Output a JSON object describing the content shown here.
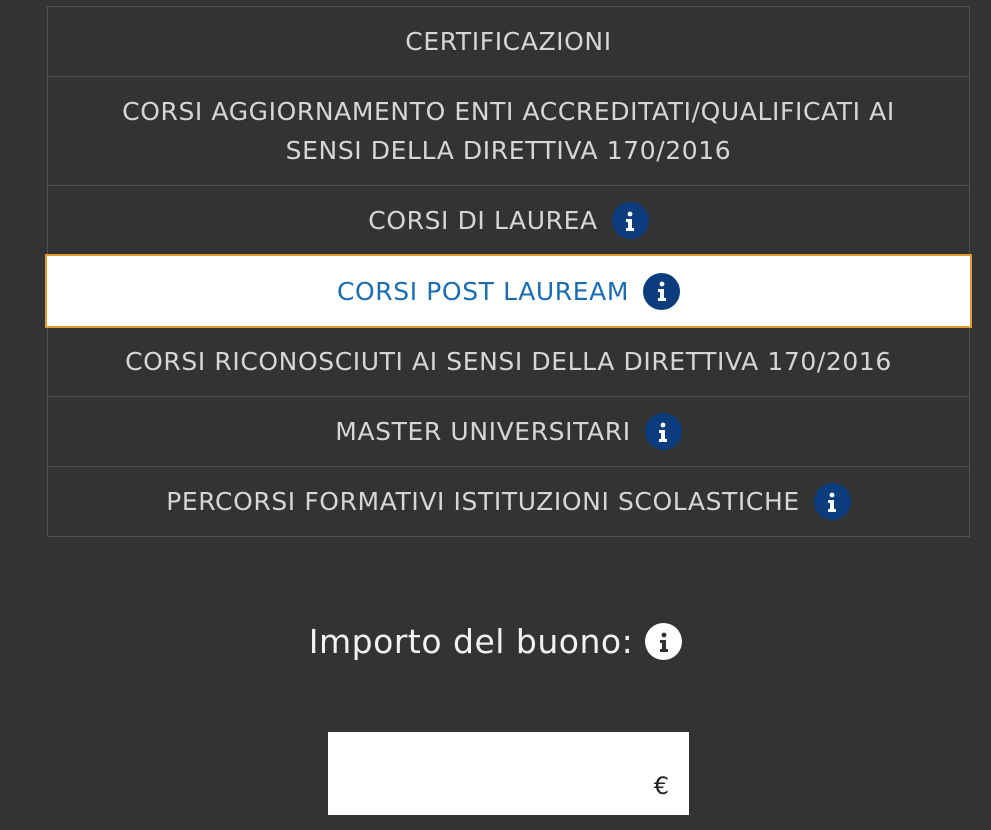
{
  "categories": [
    {
      "label": "CERTIFICAZIONI",
      "info": false,
      "selected": false
    },
    {
      "label": "CORSI AGGIORNAMENTO ENTI ACCREDITATI/QUALIFICATI AI SENSI DELLA DIRETTIVA 170/2016",
      "info": false,
      "selected": false
    },
    {
      "label": "CORSI DI LAUREA",
      "info": true,
      "selected": false
    },
    {
      "label": "CORSI POST LAUREAM",
      "info": true,
      "selected": true
    },
    {
      "label": "CORSI RICONOSCIUTI AI SENSI DELLA DIRETTIVA 170/2016",
      "info": false,
      "selected": false
    },
    {
      "label": "MASTER UNIVERSITARI",
      "info": true,
      "selected": false
    },
    {
      "label": "PERCORSI FORMATIVI ISTITUZIONI SCOLASTICHE",
      "info": true,
      "selected": false
    }
  ],
  "amount": {
    "label": "Importo del buono:",
    "value": "",
    "currency": "€"
  },
  "colors": {
    "background": "#333333",
    "info_icon": "#0b3d7e",
    "selected_text": "#1b6db2",
    "selected_border": "#e59a2c"
  },
  "icons": {
    "info": "info-icon"
  }
}
